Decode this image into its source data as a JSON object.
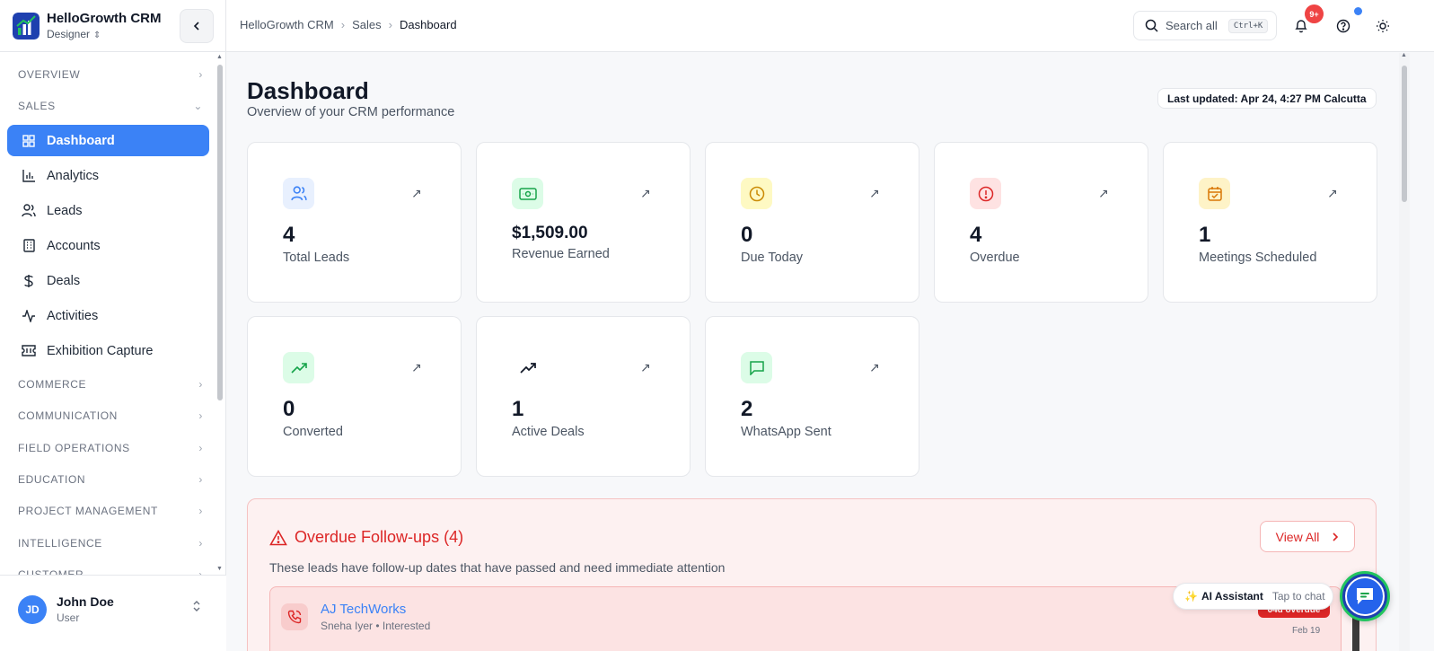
{
  "brand": {
    "name": "HelloGrowth CRM",
    "role": "Designer"
  },
  "sidebar": {
    "sections": [
      {
        "label": "OVERVIEW",
        "chevron": "›"
      },
      {
        "label": "SALES",
        "chevron": "⌄"
      },
      {
        "label": "COMMERCE",
        "chevron": "›"
      },
      {
        "label": "COMMUNICATION",
        "chevron": "›"
      },
      {
        "label": "FIELD OPERATIONS",
        "chevron": "›"
      },
      {
        "label": "EDUCATION",
        "chevron": "›"
      },
      {
        "label": "PROJECT MANAGEMENT",
        "chevron": "›"
      },
      {
        "label": "INTELLIGENCE",
        "chevron": "›"
      },
      {
        "label": "CUSTOMER",
        "chevron": "›"
      }
    ],
    "items": [
      {
        "label": "Dashboard",
        "icon": "layout-grid-icon",
        "active": true
      },
      {
        "label": "Analytics",
        "icon": "bar-chart-icon"
      },
      {
        "label": "Leads",
        "icon": "users-icon"
      },
      {
        "label": "Accounts",
        "icon": "building-icon"
      },
      {
        "label": "Deals",
        "icon": "dollar-icon"
      },
      {
        "label": "Activities",
        "icon": "activity-icon"
      },
      {
        "label": "Exhibition Capture",
        "icon": "ticket-icon"
      }
    ]
  },
  "user": {
    "initials": "JD",
    "name": "John Doe",
    "role": "User"
  },
  "topbar": {
    "breadcrumb": [
      "HelloGrowth CRM",
      "Sales",
      "Dashboard"
    ],
    "search_label": "Search all",
    "search_shortcut": "Ctrl+K",
    "notification_count": "9+"
  },
  "page": {
    "title": "Dashboard",
    "subtitle": "Overview of your CRM performance",
    "last_updated": "Last updated: Apr 24, 4:27 PM Calcutta"
  },
  "stats": [
    {
      "value": "4",
      "label": "Total Leads",
      "icon": "users-icon",
      "color": "#3b82f6",
      "bg": "#e8f0fe"
    },
    {
      "value": "$1,509.00",
      "label": "Revenue Earned",
      "icon": "banknote-icon",
      "color": "#16a34a",
      "bg": "#dcfce7"
    },
    {
      "value": "0",
      "label": "Due Today",
      "icon": "clock-icon",
      "color": "#ca8a04",
      "bg": "#fef9c3"
    },
    {
      "value": "4",
      "label": "Overdue",
      "icon": "alert-circle-icon",
      "color": "#dc2626",
      "bg": "#fee2e2"
    },
    {
      "value": "1",
      "label": "Meetings Scheduled",
      "icon": "calendar-check-icon",
      "color": "#d97706",
      "bg": "#fef3c7"
    },
    {
      "value": "0",
      "label": "Converted",
      "icon": "trending-up-icon",
      "color": "#16a34a",
      "bg": "#dcfce7"
    },
    {
      "value": "1",
      "label": "Active Deals",
      "icon": "trending-up-icon",
      "color": "#111827",
      "bg": "#ffffff"
    },
    {
      "value": "2",
      "label": "WhatsApp Sent",
      "icon": "message-square-icon",
      "color": "#16a34a",
      "bg": "#dcfce7"
    }
  ],
  "overdue": {
    "title": "Overdue Follow-ups (4)",
    "description": "These leads have follow-up dates that have passed and need immediate attention",
    "view_all": "View All",
    "leads": [
      {
        "name": "AJ TechWorks",
        "meta": "Sneha Iyer • Interested",
        "badge": "64d overdue",
        "date": "Feb 19"
      }
    ]
  },
  "assistant": {
    "title": "AI Assistant",
    "hint": "Tap to chat"
  },
  "colors": {
    "accent": "#3b82f6",
    "danger": "#dc2626",
    "success": "#22c55e"
  }
}
